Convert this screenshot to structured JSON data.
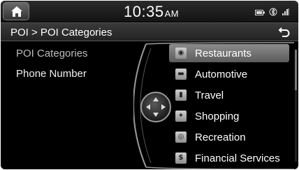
{
  "status_bar": {
    "time": "10:35",
    "ampm": "AM",
    "icons": [
      "battery-icon",
      "bluetooth-icon",
      "signal-icon"
    ]
  },
  "title_bar": {
    "breadcrumb": "POI > POI Categories",
    "back_icon": "back-arrow-icon"
  },
  "left_menu": {
    "items": [
      {
        "label": "POI Categories",
        "active": true
      },
      {
        "label": "Phone Number",
        "active": false
      }
    ]
  },
  "category_list": {
    "items": [
      {
        "label": "Restaurants",
        "icon": "restaurant-icon",
        "selected": true
      },
      {
        "label": "Automotive",
        "icon": "car-icon",
        "selected": false
      },
      {
        "label": "Travel",
        "icon": "suitcase-icon",
        "selected": false
      },
      {
        "label": "Shopping",
        "icon": "shopping-icon",
        "selected": false
      },
      {
        "label": "Recreation",
        "icon": "recreation-icon",
        "selected": false
      },
      {
        "label": "Financial Services",
        "icon": "dollar-icon",
        "selected": false
      }
    ]
  },
  "colors": {
    "background": "#000000",
    "text": "#ffffff",
    "inactive_text": "#bdbdbd",
    "selection": "#7a7a7a"
  }
}
